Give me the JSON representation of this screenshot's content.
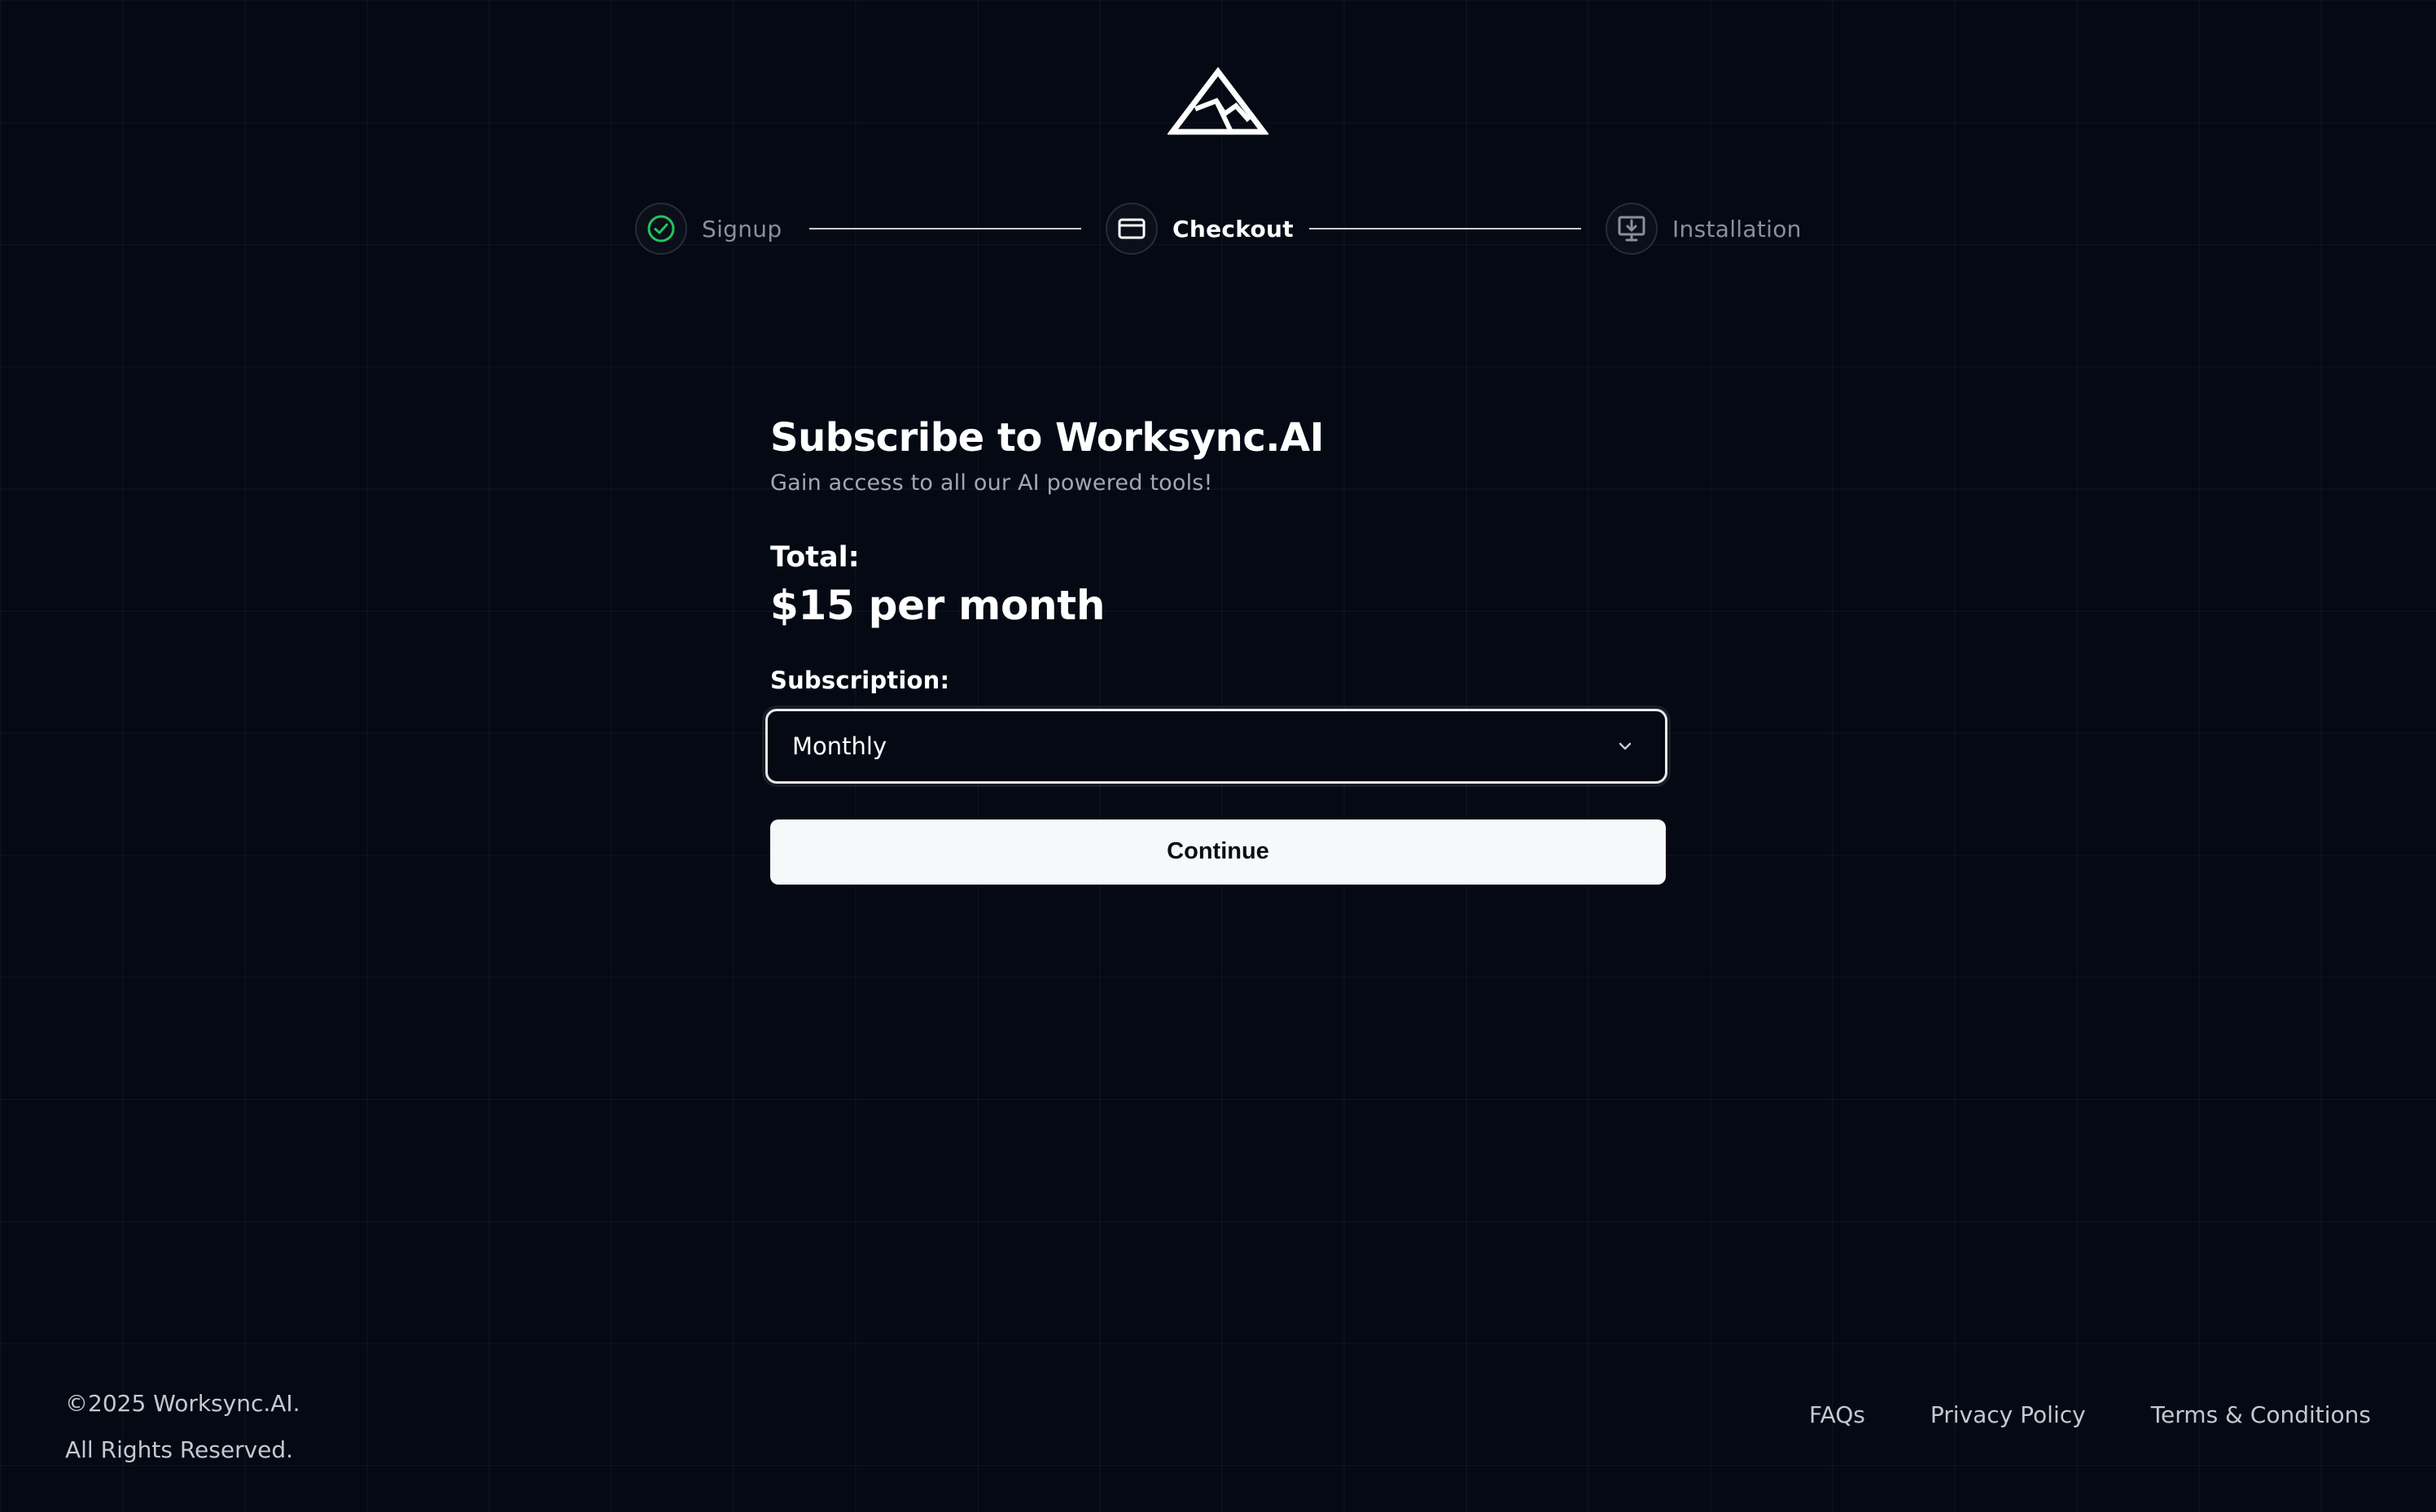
{
  "stepper": {
    "steps": [
      {
        "label": "Signup",
        "state": "complete",
        "icon": "check-circle-icon"
      },
      {
        "label": "Checkout",
        "state": "active",
        "icon": "credit-card-icon"
      },
      {
        "label": "Installation",
        "state": "pending",
        "icon": "monitor-download-icon"
      }
    ]
  },
  "logo": {
    "icon": "mountain-logo-icon"
  },
  "checkout": {
    "title": "Subscribe to Worksync.AI",
    "subtitle": "Gain access to all our AI powered tools!",
    "total_label": "Total:",
    "total_value": "$15 per month",
    "subscription_label": "Subscription:",
    "subscription_selected": "Monthly",
    "continue_label": "Continue"
  },
  "footer": {
    "copyright_line1": "©2025 Worksync.AI.",
    "copyright_line2": "All Rights Reserved.",
    "links": [
      "FAQs",
      "Privacy Policy",
      "Terms & Conditions"
    ]
  },
  "colors": {
    "background": "#050914",
    "success": "#22c55e",
    "text_primary": "#ffffff",
    "text_muted": "#8a8f9c",
    "button_bg": "#f7f8fa"
  }
}
